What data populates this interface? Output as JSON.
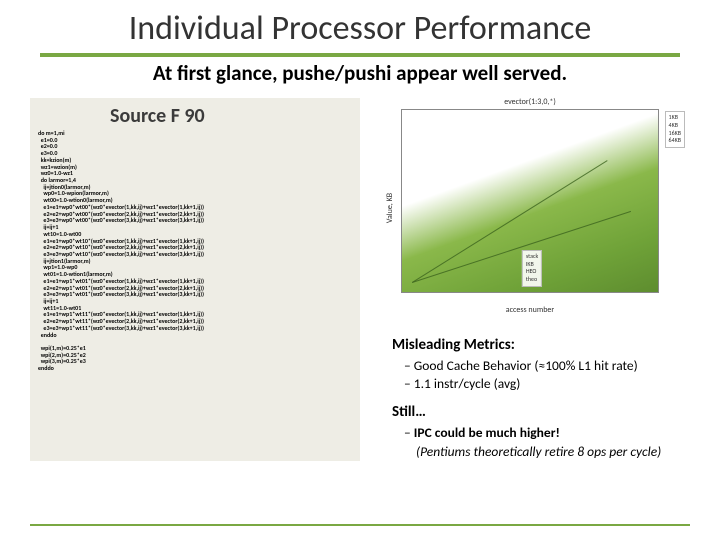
{
  "header": {
    "title": "Individual Processor Performance",
    "subtitle": "At first glance, pushe/pushi appear well served."
  },
  "code": {
    "title": "Source F 90",
    "body": "do m=1,mi\n  e1=0.0\n  e2=0.0\n  e3=0.0\n  kk=kzion(m)\n  wz1=wzion(m)\n  wz0=1.0-wz1\n  do larmor=1,4\n    ij=jtion0(larmor,m)\n    wp0=1.0-wpion(larmor,m)\n    wt00=1.0-wtion0(larmor,m)\n    e1=e1+wp0*wt00*(wz0*evector(1,kk,ij)+wz1*evector(1,kk+1,ij))\n    e2=e2+wp0*wt00*(wz0*evector(2,kk,ij)+wz1*evector(2,kk+1,ij))\n    e3=e3+wp0*wt00*(wz0*evector(3,kk,ij)+wz1*evector(3,kk+1,ij))\n    ij=ij+1\n    wt10=1.0-wt00\n    e1=e1+wp0*wt10*(wz0*evector(1,kk,ij)+wz1*evector(1,kk+1,ij))\n    e2=e2+wp0*wt10*(wz0*evector(2,kk,ij)+wz1*evector(2,kk+1,ij))\n    e3=e3+wp0*wt10*(wz0*evector(3,kk,ij)+wz1*evector(3,kk+1,ij))\n    ij=jtion1(larmor,m)\n    wp1=1.0-wp0\n    wt01=1.0-wtion1(larmor,m)\n    e1=e1+wp1*wt01*(wz0*evector(1,kk,ij)+wz1*evector(1,kk+1,ij))\n    e2=e2+wp1*wt01*(wz0*evector(2,kk,ij)+wz1*evector(2,kk+1,ij))\n    e3=e3+wp1*wt01*(wz0*evector(3,kk,ij)+wz1*evector(3,kk+1,ij))\n    ij=ij+1\n    wt11=1.0-wt01\n    e1=e1+wp1*wt11*(wz0*evector(1,kk,ij)+wz1*evector(1,kk+1,ij))\n    e2=e2+wp1*wt11*(wz0*evector(2,kk,ij)+wz1*evector(2,kk+1,ij))\n    e3=e3+wp1*wt11*(wz0*evector(3,kk,ij)+wz1*evector(3,kk+1,ij))\n  enddo\n\n  wpi(1,m)=0.25*e1\n  wpi(2,m)=0.25*e2\n  wpi(3,m)=0.25*e3\nenddo"
  },
  "chart": {
    "title": "evector(1:3,0,*)",
    "ylabel": "Value, KB",
    "xlabel": "access number",
    "legend_top": [
      "1KB",
      "4KB",
      "16KB",
      "64KB"
    ],
    "legend_bottom": [
      "stack",
      "IKB",
      "HEO",
      "theo"
    ]
  },
  "analysis": {
    "heading1": "Misleading Metrics:",
    "points1": [
      "Good Cache Behavior (≈100% L1 hit rate)",
      "1.1 instr/cycle (avg)"
    ],
    "heading2": "Still…",
    "points2": [
      {
        "text": "IPC could be much higher!",
        "bold": true
      },
      {
        "text": "(Pentiums theoretically retire 8 ops per cycle)",
        "italic": true
      }
    ]
  }
}
